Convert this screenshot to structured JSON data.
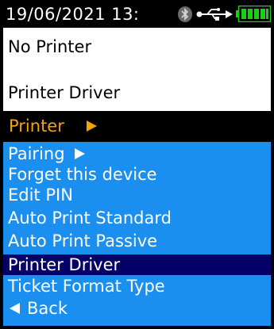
{
  "status_bar": {
    "datetime": "19/06/2021 13:",
    "icons": [
      "bluetooth-icon",
      "usb-icon",
      "battery-icon"
    ],
    "battery_color": "#18d018"
  },
  "info": {
    "line1": "No Printer",
    "line2": "Printer Driver"
  },
  "menu": {
    "title": "Printer",
    "title_color": "#f5a300",
    "background_color": "#1a8ff0",
    "selected_color": "#050068",
    "items": [
      {
        "label": "Pairing",
        "has_submenu": true
      },
      {
        "label": "Forget this device"
      },
      {
        "label": "Edit PIN"
      },
      {
        "label": "Auto Print Standard"
      },
      {
        "label": "Auto Print Passive"
      },
      {
        "label": "Printer Driver",
        "selected": true
      },
      {
        "label": "Ticket Format Type"
      },
      {
        "label": "Back",
        "back": true
      }
    ]
  }
}
